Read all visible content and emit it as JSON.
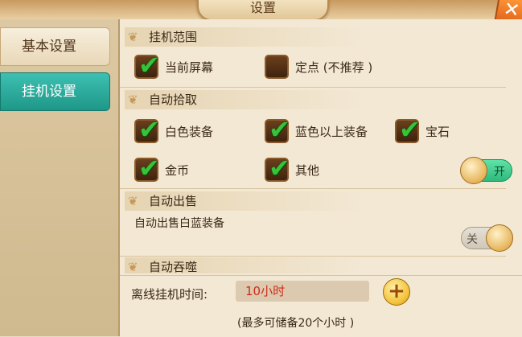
{
  "header": {
    "title": "设置",
    "close_glyph": "✕"
  },
  "sidebar": {
    "items": [
      {
        "label": "基本设置",
        "active": false
      },
      {
        "label": "挂机设置",
        "active": true
      }
    ]
  },
  "sections": {
    "range": {
      "title": "挂机范围",
      "options": [
        {
          "label": "当前屏幕",
          "checked": true
        },
        {
          "label": "定点 (不推荐 )",
          "checked": false
        }
      ]
    },
    "pickup": {
      "title": "自动拾取",
      "options": [
        {
          "label": "白色装备",
          "checked": true
        },
        {
          "label": "蓝色以上装备",
          "checked": true
        },
        {
          "label": "宝石",
          "checked": true
        },
        {
          "label": "金币",
          "checked": true
        },
        {
          "label": "其他",
          "checked": true
        }
      ],
      "toggle_label": "开"
    },
    "sell": {
      "title": "自动出售",
      "description": "自动出售白蓝装备",
      "toggle_label": "关"
    },
    "devour": {
      "title": "自动吞噬"
    }
  },
  "offline": {
    "label": "离线挂机时间:",
    "value": "10小时",
    "hint": "(最多可储备20个小时 )"
  },
  "icons": {
    "check": "check-icon",
    "plus": "plus-icon",
    "swirl": "swirl-icon",
    "close": "close-icon"
  },
  "colors": {
    "accent_active_tab": "#1e9788",
    "toggle_on": "#2fb97c",
    "offline_value_text": "#d22a16"
  }
}
